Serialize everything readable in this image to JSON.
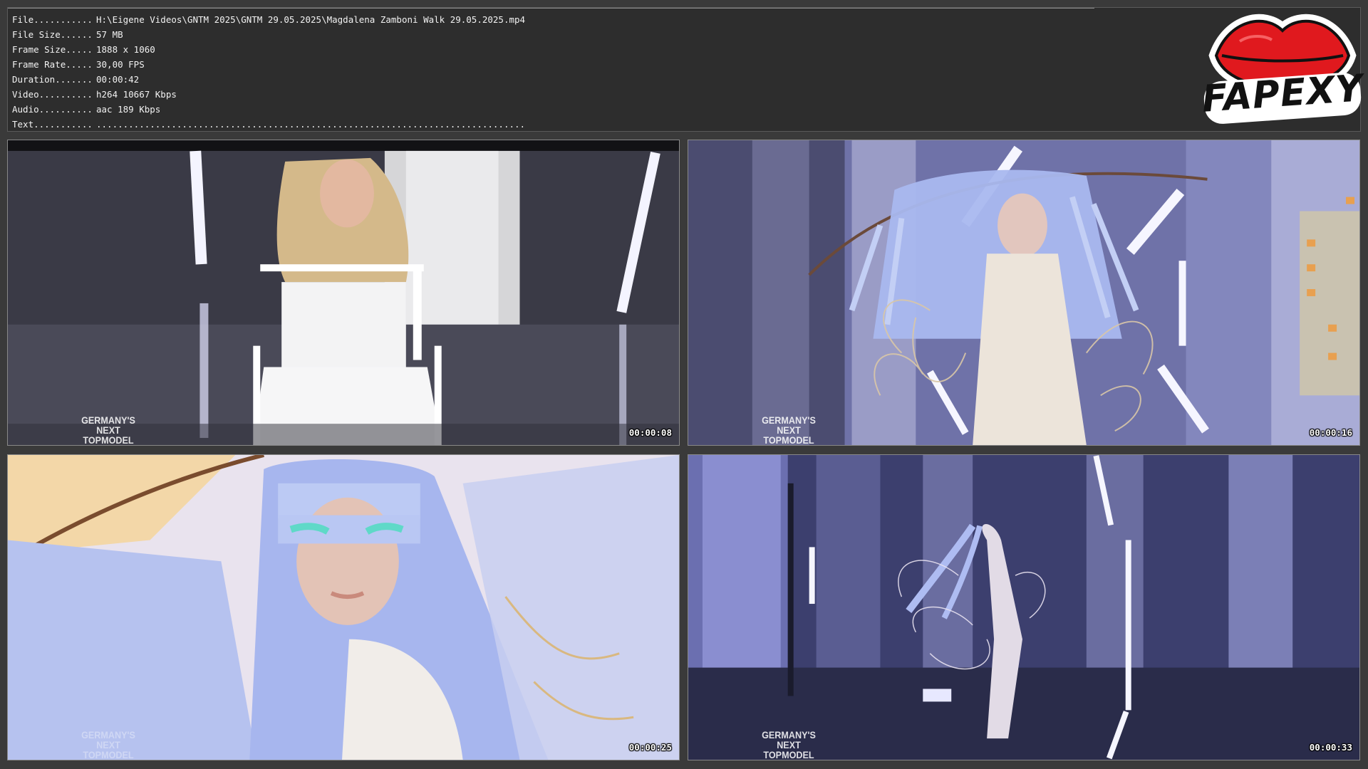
{
  "info": {
    "rows": [
      {
        "key": "File...........",
        "value": "H:\\Eigene Videos\\GNTM 2025\\GNTM 29.05.2025\\Magdalena Zamboni Walk 29.05.2025.mp4"
      },
      {
        "key": "File Size......",
        "value": "57 MB"
      },
      {
        "key": "Frame Size.....",
        "value": "1888 x 1060"
      },
      {
        "key": "Frame Rate.....",
        "value": "30,00 FPS"
      },
      {
        "key": "Duration.......",
        "value": "00:00:42"
      },
      {
        "key": "Video..........",
        "value": "h264 10667 Kbps"
      },
      {
        "key": "Audio..........",
        "value": "aac 189 Kbps"
      },
      {
        "key": "Text...........",
        "value": "................................................................................"
      }
    ]
  },
  "logo": {
    "text": "FAPEXY",
    "lip_color": "#e0191e"
  },
  "thumbnails": [
    {
      "timestamp": "00:00:08",
      "watermark": "GERMANY'S NEXT TOPMODEL"
    },
    {
      "timestamp": "00:00:16",
      "watermark": "GERMANY'S NEXT TOPMODEL"
    },
    {
      "timestamp": "00:00:25",
      "watermark": "GERMANY'S NEXT TOPMODEL"
    },
    {
      "timestamp": "00:00:33",
      "watermark": "GERMANY'S NEXT TOPMODEL"
    }
  ],
  "colors": {
    "background": "#3a3a3a",
    "panel": "#2d2d2d",
    "text": "#f2f2f2",
    "wig_blue": "#a9b8ef",
    "stage_purple": "#6b6fb0"
  }
}
